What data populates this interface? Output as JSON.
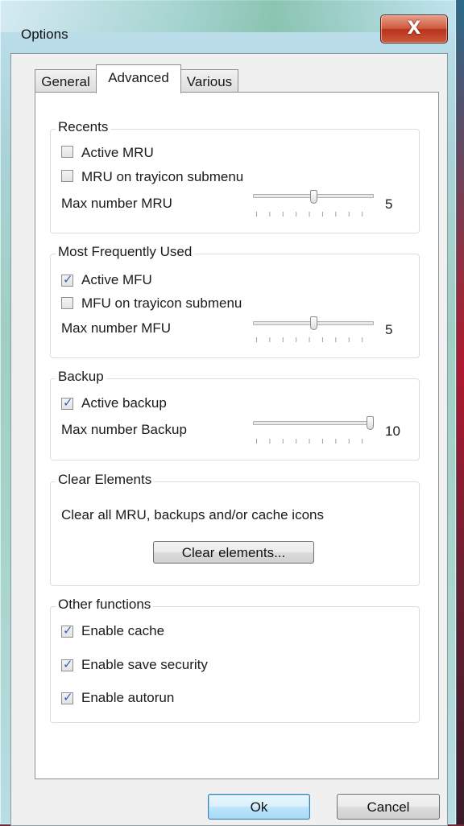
{
  "window": {
    "title": "Options",
    "close_glyph": "X"
  },
  "tabs": [
    {
      "label": "General"
    },
    {
      "label": "Advanced"
    },
    {
      "label": "Various"
    }
  ],
  "recents": {
    "legend": "Recents",
    "active_mru": {
      "label": "Active MRU",
      "checked": false
    },
    "mru_tray": {
      "label": "MRU on trayicon submenu",
      "checked": false
    },
    "max_label": "Max number MRU",
    "max_value": "5",
    "slider_fraction": 0.5
  },
  "mfu": {
    "legend": "Most Frequently Used",
    "active_mfu": {
      "label": "Active MFU",
      "checked": true
    },
    "mfu_tray": {
      "label": "MFU on trayicon submenu",
      "checked": false
    },
    "max_label": "Max number MFU",
    "max_value": "5",
    "slider_fraction": 0.5
  },
  "backup": {
    "legend": "Backup",
    "active_backup": {
      "label": "Active backup",
      "checked": true
    },
    "max_label": "Max number Backup",
    "max_value": "10",
    "slider_fraction": 1.0
  },
  "clear": {
    "legend": "Clear Elements",
    "description": "Clear all MRU, backups and/or cache icons",
    "button_label": "Clear elements..."
  },
  "other": {
    "legend": "Other functions",
    "enable_cache": {
      "label": "Enable cache",
      "checked": true
    },
    "enable_save_security": {
      "label": "Enable save security",
      "checked": true
    },
    "enable_autorun": {
      "label": "Enable autorun",
      "checked": true
    }
  },
  "footer": {
    "ok_label": "Ok",
    "cancel_label": "Cancel"
  }
}
